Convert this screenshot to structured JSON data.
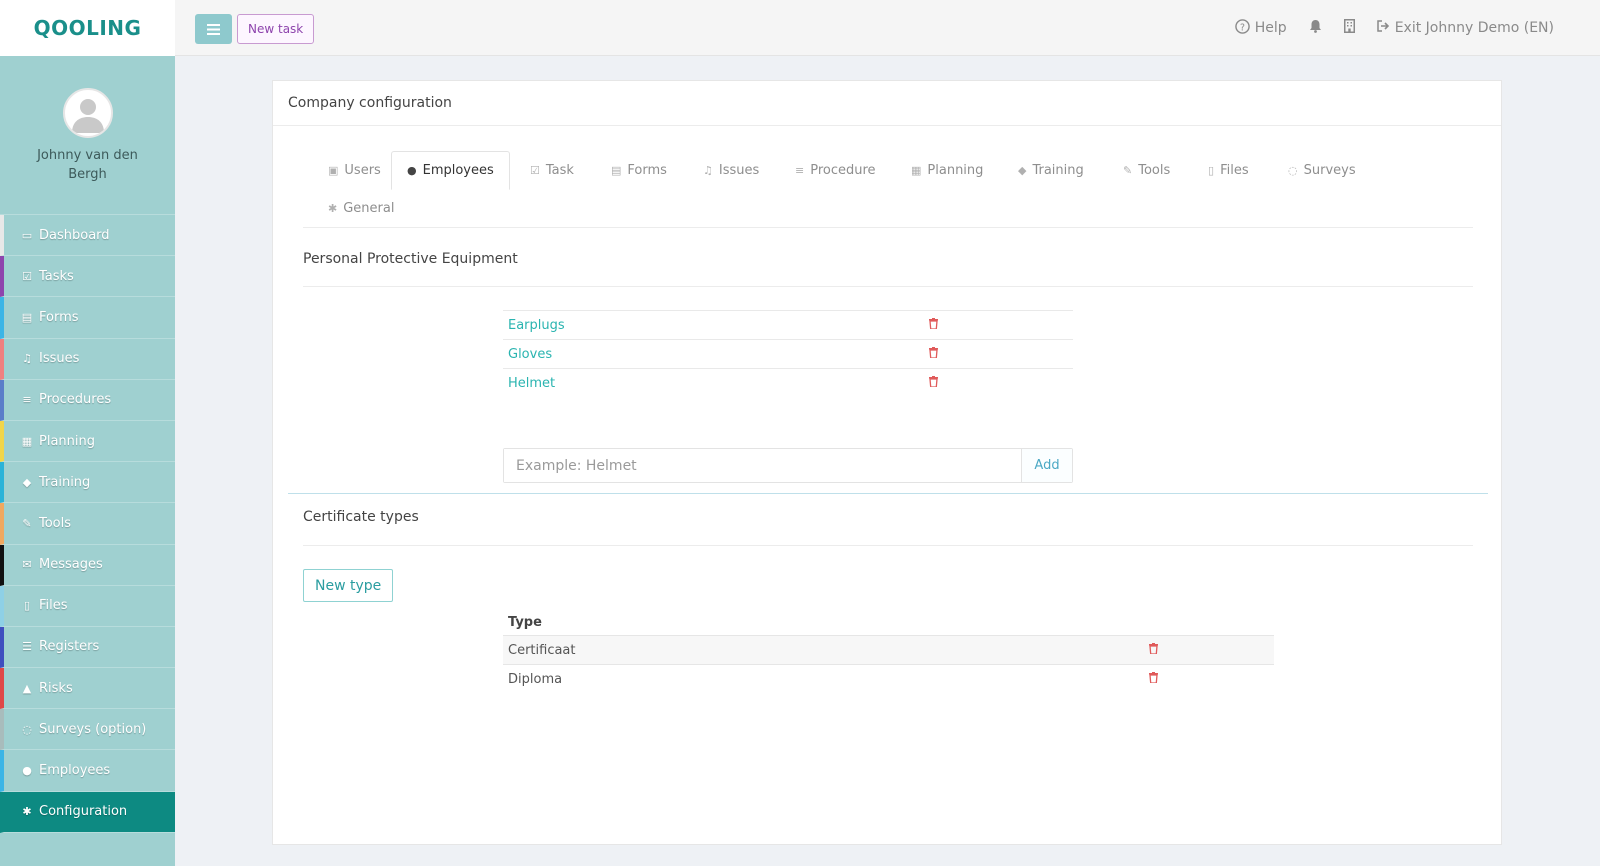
{
  "brand": {
    "logo_text": "QOOLING"
  },
  "topbar": {
    "new_task_label": "New task",
    "help_label": "Help",
    "exit_label": "Exit Johnny Demo (EN)"
  },
  "user": {
    "name": "Johnny van den Bergh"
  },
  "sidebar": {
    "items": [
      {
        "label": "Dashboard",
        "icon": "monitor-icon",
        "color": "#e8e8e8"
      },
      {
        "label": "Tasks",
        "icon": "checkbox-icon",
        "color": "#8e44ad"
      },
      {
        "label": "Forms",
        "icon": "document-icon",
        "color": "#3bb5e6"
      },
      {
        "label": "Issues",
        "icon": "bell-icon",
        "color": "#f08080"
      },
      {
        "label": "Procedures",
        "icon": "list-icon",
        "color": "#5b7ec9"
      },
      {
        "label": "Planning",
        "icon": "calendar-icon",
        "color": "#f1d54a"
      },
      {
        "label": "Training",
        "icon": "graduation-cap-icon",
        "color": "#2bb3d8"
      },
      {
        "label": "Tools",
        "icon": "wrench-icon",
        "color": "#f0a860"
      },
      {
        "label": "Messages",
        "icon": "envelope-icon",
        "color": "#111111"
      },
      {
        "label": "Files",
        "icon": "file-icon",
        "color": "#8ed0e6"
      },
      {
        "label": "Registers",
        "icon": "lines-icon",
        "color": "#3f4fbf"
      },
      {
        "label": "Risks",
        "icon": "warning-icon",
        "color": "#e04848"
      },
      {
        "label": "Surveys (option)",
        "icon": "comment-icon",
        "color": "#a8bcbc"
      },
      {
        "label": "Employees",
        "icon": "users-icon",
        "color": "#3bb5e6"
      },
      {
        "label": "Configuration",
        "icon": "gear-icon",
        "color": "#0d8a82"
      }
    ]
  },
  "page": {
    "title": "Company configuration"
  },
  "tabs": [
    {
      "label": "Users",
      "icon": "id-card-icon"
    },
    {
      "label": "Employees",
      "icon": "users-icon",
      "active": true
    },
    {
      "label": "Task",
      "icon": "checkbox-icon"
    },
    {
      "label": "Forms",
      "icon": "document-icon"
    },
    {
      "label": "Issues",
      "icon": "bell-icon"
    },
    {
      "label": "Procedure",
      "icon": "list-icon"
    },
    {
      "label": "Planning",
      "icon": "calendar-icon"
    },
    {
      "label": "Training",
      "icon": "graduation-cap-icon"
    },
    {
      "label": "Tools",
      "icon": "wrench-icon"
    },
    {
      "label": "Files",
      "icon": "file-icon"
    },
    {
      "label": "Surveys",
      "icon": "comment-icon"
    },
    {
      "label": "General",
      "icon": "gear-icon"
    }
  ],
  "ppe": {
    "title": "Personal Protective Equipment",
    "items": [
      "Earplugs",
      "Gloves",
      "Helmet"
    ],
    "input_placeholder": "Example: Helmet",
    "add_label": "Add"
  },
  "certificates": {
    "title": "Certificate types",
    "new_type_label": "New type",
    "column_header": "Type",
    "rows": [
      "Certificaat",
      "Diploma"
    ]
  },
  "colors": {
    "accent": "#0d8a82",
    "sidebar": "#9fd0d0",
    "link": "#2ab4b0",
    "danger": "#e05a5a"
  }
}
